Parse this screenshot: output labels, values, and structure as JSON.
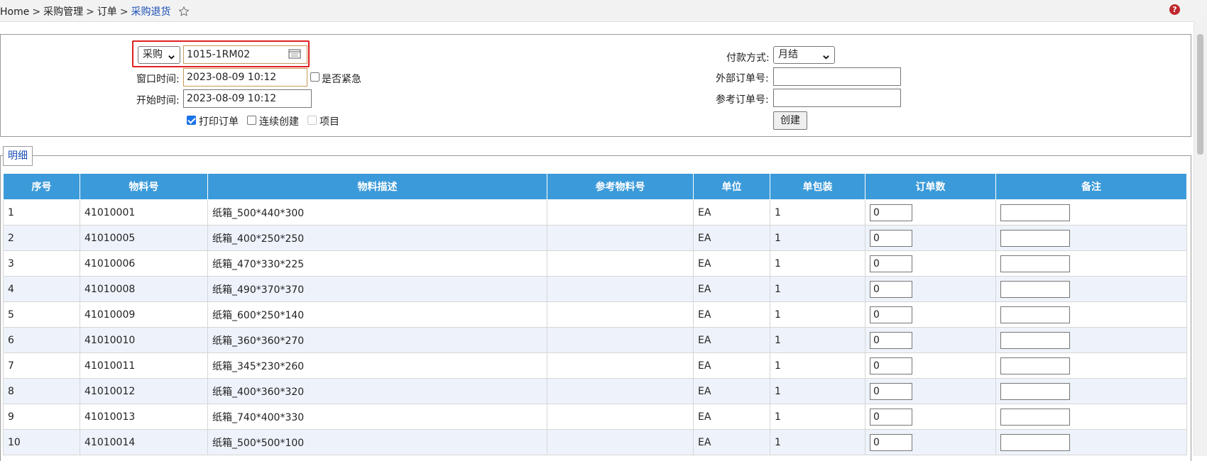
{
  "breadcrumb": {
    "items": [
      "Home",
      "采购管理",
      "订单"
    ],
    "current": "采购退货",
    "separator": ">"
  },
  "form": {
    "type_select": "采购",
    "order_code": "1015-1RM02",
    "window_time_label": "窗口时间:",
    "window_time_value": "2023-08-09 10:12",
    "urgent_label": "是否紧急",
    "start_time_label": "开始时间:",
    "start_time_value": "2023-08-09 10:12",
    "print_order_label": "打印订单",
    "continuous_create_label": "连续创建",
    "project_label": "项目",
    "payment_label": "付款方式:",
    "payment_value": "月结",
    "external_order_label": "外部订单号:",
    "reference_order_label": "参考订单号:",
    "create_button": "创建"
  },
  "detail": {
    "tab_label": "明细",
    "columns": [
      "序号",
      "物料号",
      "物料描述",
      "参考物料号",
      "单位",
      "单包装",
      "订单数",
      "备注"
    ],
    "rows": [
      {
        "no": "1",
        "material": "41010001",
        "desc": "纸箱_500*440*300",
        "ref": "",
        "unit": "EA",
        "pack": "1",
        "qty": "0"
      },
      {
        "no": "2",
        "material": "41010005",
        "desc": "纸箱_400*250*250",
        "ref": "",
        "unit": "EA",
        "pack": "1",
        "qty": "0"
      },
      {
        "no": "3",
        "material": "41010006",
        "desc": "纸箱_470*330*225",
        "ref": "",
        "unit": "EA",
        "pack": "1",
        "qty": "0"
      },
      {
        "no": "4",
        "material": "41010008",
        "desc": "纸箱_490*370*370",
        "ref": "",
        "unit": "EA",
        "pack": "1",
        "qty": "0"
      },
      {
        "no": "5",
        "material": "41010009",
        "desc": "纸箱_600*250*140",
        "ref": "",
        "unit": "EA",
        "pack": "1",
        "qty": "0"
      },
      {
        "no": "6",
        "material": "41010010",
        "desc": "纸箱_360*360*270",
        "ref": "",
        "unit": "EA",
        "pack": "1",
        "qty": "0"
      },
      {
        "no": "7",
        "material": "41010011",
        "desc": "纸箱_345*230*260",
        "ref": "",
        "unit": "EA",
        "pack": "1",
        "qty": "0"
      },
      {
        "no": "8",
        "material": "41010012",
        "desc": "纸箱_400*360*320",
        "ref": "",
        "unit": "EA",
        "pack": "1",
        "qty": "0"
      },
      {
        "no": "9",
        "material": "41010013",
        "desc": "纸箱_740*400*330",
        "ref": "",
        "unit": "EA",
        "pack": "1",
        "qty": "0"
      },
      {
        "no": "10",
        "material": "41010014",
        "desc": "纸箱_500*500*100",
        "ref": "",
        "unit": "EA",
        "pack": "1",
        "qty": "0"
      }
    ]
  },
  "colors": {
    "header_bg": "#3b9ad9",
    "alt_row_bg": "#eef3fb",
    "highlight_border": "#e02020",
    "link": "#1a4fb5"
  },
  "icons": {
    "star": "star-outline-icon",
    "help": "help-icon",
    "calendar": "calendar-icon"
  }
}
